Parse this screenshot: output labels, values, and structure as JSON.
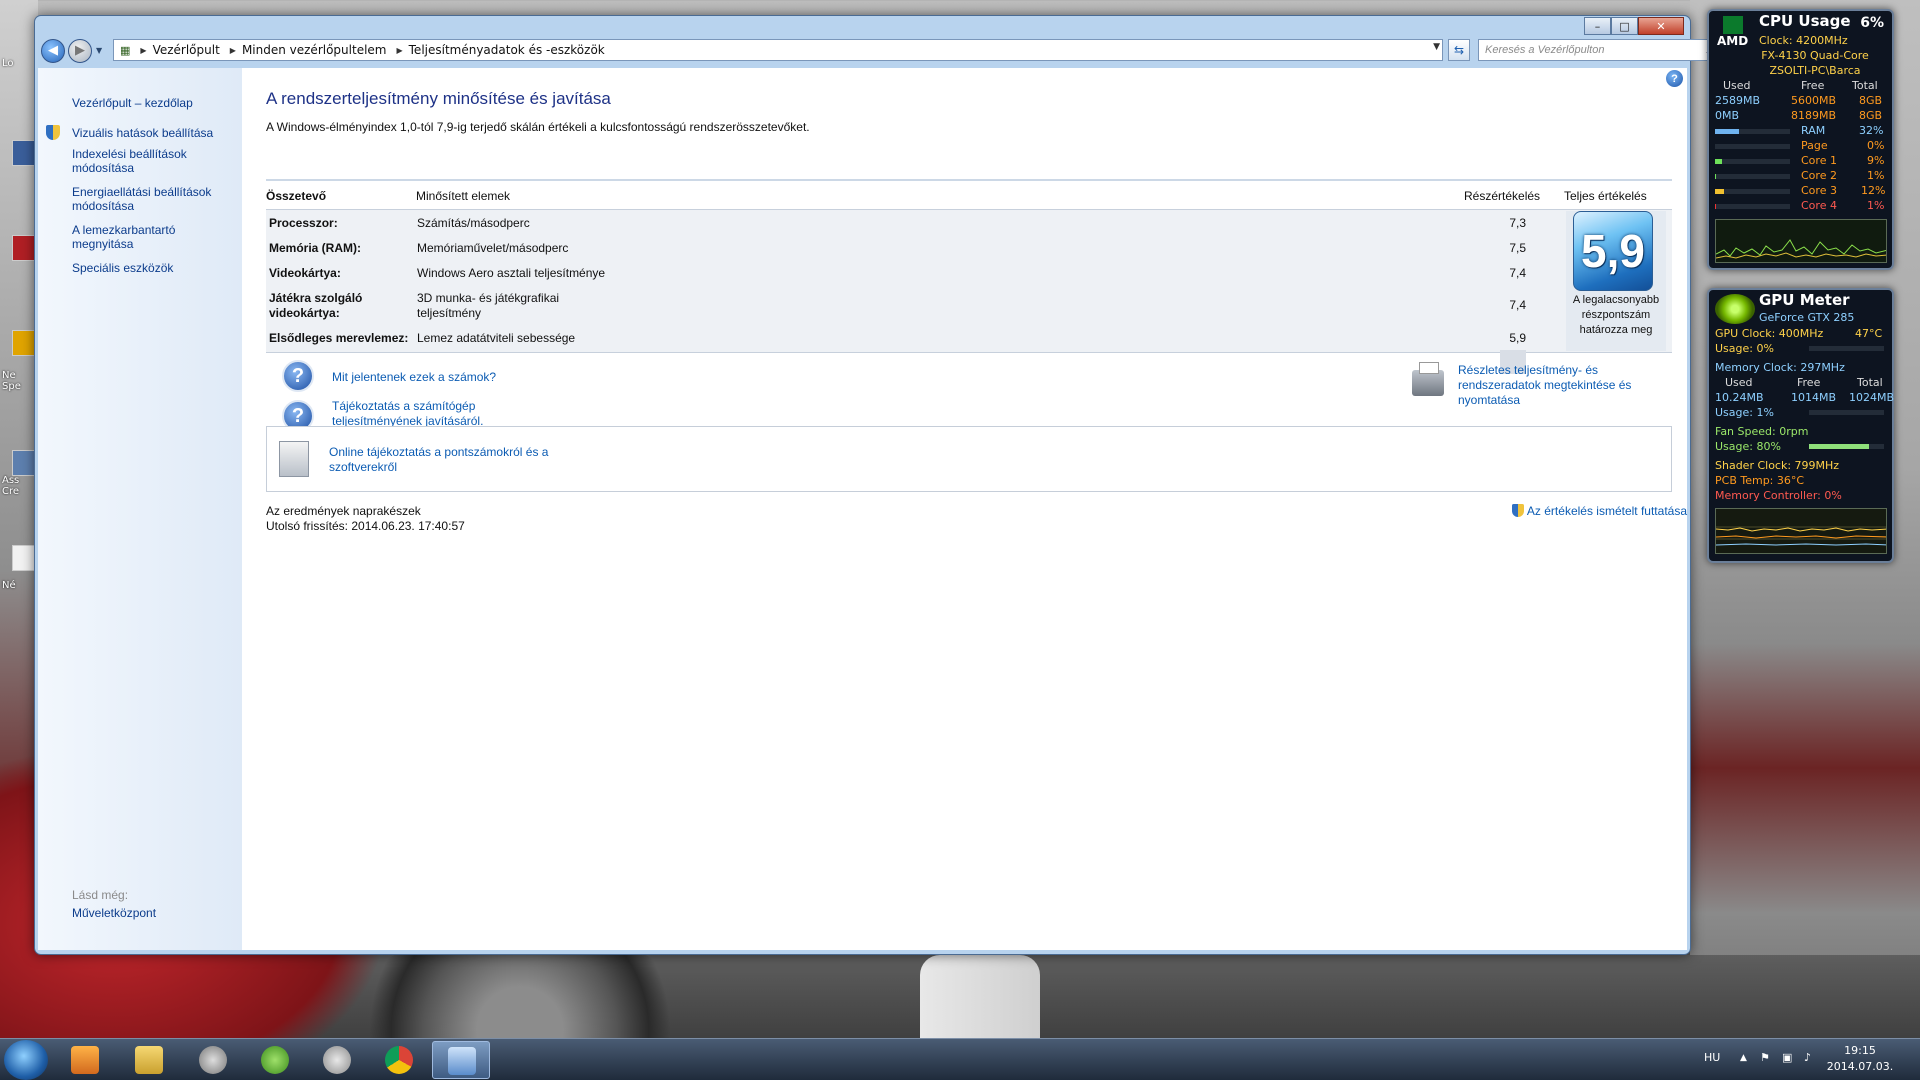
{
  "window": {
    "breadcrumb": [
      "Vezérlőpult",
      "Minden vezérlőpultelem",
      "Teljesítményadatok és -eszközök"
    ],
    "search_placeholder": "Keresés a Vezérlőpulton",
    "caption_minimize": "–",
    "caption_maximize": "□",
    "caption_close": "✕"
  },
  "sidebar": {
    "home": "Vezérlőpult – kezdőlap",
    "items": [
      {
        "label": "Vizuális hatások beállítása",
        "shield": true
      },
      {
        "label": "Indexelési beállítások módosítása"
      },
      {
        "label": "Energiaellátási beállítások módosítása"
      },
      {
        "label": "A lemezkarbantartó megnyitása"
      },
      {
        "label": "Speciális eszközök"
      }
    ],
    "see_also": "Lásd még:",
    "see_also_link": "Műveletközpont"
  },
  "main": {
    "title": "A rendszerteljesítmény minősítése és javítása",
    "subtitle": "A Windows-élményindex 1,0-tól 7,9-ig terjedő skálán értékeli a kulcsfontosságú rendszerösszetevőket.",
    "headers": {
      "component": "Összetevő",
      "rated": "Minősített elemek",
      "subscore": "Részértékelés",
      "base": "Teljes értékelés"
    },
    "rows": [
      {
        "component": "Processzor:",
        "rated": "Számítás/másodperc",
        "score": "7,3"
      },
      {
        "component": "Memória (RAM):",
        "rated": "Memóriaművelet/másodperc",
        "score": "7,5"
      },
      {
        "component": "Videokártya:",
        "rated": "Windows Aero asztali teljesítménye",
        "score": "7,4"
      },
      {
        "component": "Játékra szolgáló videokártya:",
        "rated": "3D munka- és játékgrafikai teljesítmény",
        "score": "7,4"
      },
      {
        "component": "Elsődleges merevlemez:",
        "rated": "Lemez adatátviteli sebessége",
        "score": "5,9"
      }
    ],
    "base_score": "5,9",
    "base_caption": "A legalacsonyabb részpontszám határozza meg",
    "link_numbers": "Mit jelentenek ezek a számok?",
    "link_tips": "Tájékoztatás a számítógép teljesítményének javításáról.",
    "link_details": "Részletes teljesítmény- és rendszeradatok megtekintése és nyomtatása",
    "link_online": "Online tájékoztatás a pontszámokról és a szoftverekről",
    "status": "Az eredmények naprakészek",
    "last_update": "Utolsó frissítés: 2014.06.23. 17:40:57",
    "rerun": "Az értékelés ismételt futtatása"
  },
  "cpu_gadget": {
    "title": "CPU Usage",
    "percent": "6%",
    "brand": "AMD",
    "clock": "Clock: 4200MHz",
    "model": "FX-4130 Quad-Core",
    "host": "ZSOLTI-PC\\Barca",
    "cols": [
      "Used",
      "Free",
      "Total"
    ],
    "ram_row": [
      "2589MB",
      "5600MB",
      "8GB"
    ],
    "page_row": [
      "0MB",
      "8189MB",
      "8GB"
    ],
    "meters": [
      {
        "name": "RAM",
        "value": "32%",
        "level": 0.32
      },
      {
        "name": "Page",
        "value": "0%",
        "level": 0.0
      },
      {
        "name": "Core 1",
        "value": "9%",
        "level": 0.09
      },
      {
        "name": "Core 2",
        "value": "1%",
        "level": 0.01
      },
      {
        "name": "Core 3",
        "value": "12%",
        "level": 0.12
      },
      {
        "name": "Core 4",
        "value": "1%",
        "level": 0.01
      }
    ]
  },
  "gpu_gadget": {
    "title": "GPU Meter",
    "card": "GeForce GTX 285",
    "gpu_clock": "GPU Clock: 400MHz",
    "gpu_temp": "47°C",
    "usage1": "Usage: 0%",
    "mem_clock": "Memory Clock: 297MHz",
    "cols": [
      "Used",
      "Free",
      "Total"
    ],
    "mem_row": [
      "10.24MB",
      "1014MB",
      "1024MB"
    ],
    "usage2": "Usage: 1%",
    "fan": "Fan Speed: 0rpm",
    "usage3": "Usage: 80%",
    "usage3_level": 0.8,
    "shader": "Shader Clock: 799MHz",
    "pcb": "PCB Temp: 36°C",
    "memctrl": "Memory Controller: 0%"
  },
  "desktop": {
    "labels": [
      "Lo",
      "Ne Spe",
      "Ass Cre",
      "Né"
    ]
  },
  "taskbar": {
    "lang": "HU",
    "time": "19:15",
    "date": "2014.07.03."
  }
}
